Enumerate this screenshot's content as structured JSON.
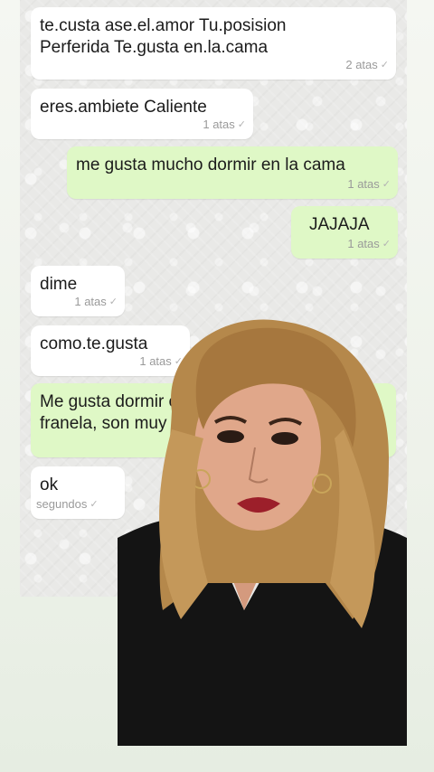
{
  "messages": [
    {
      "direction": "in",
      "text": "te.custa ase.el.amor Tu.posision\nPerferida Te.gusta en.la.cama",
      "time": "2 atas"
    },
    {
      "direction": "in",
      "text": "eres.ambiete Caliente",
      "time": "1 atas"
    },
    {
      "direction": "out",
      "text": "me gusta mucho dormir en la cama",
      "time": "1 atas"
    },
    {
      "direction": "out",
      "text": "JAJAJA",
      "time": "1 atas"
    },
    {
      "direction": "in",
      "text": "dime",
      "time": "1 atas"
    },
    {
      "direction": "in",
      "text": "como.te.gusta",
      "time": "1 atas"
    },
    {
      "direction": "out",
      "text": "Me gusta dormir cor\nfranela, son muy có",
      "time": ""
    },
    {
      "direction": "in",
      "text": "ok",
      "time": "segundos"
    }
  ],
  "icons": {
    "read_receipt": "double-check-icon"
  },
  "colors": {
    "incoming": "#ffffff",
    "outgoing": "#dff8c6",
    "time": "#9a9a9a"
  }
}
